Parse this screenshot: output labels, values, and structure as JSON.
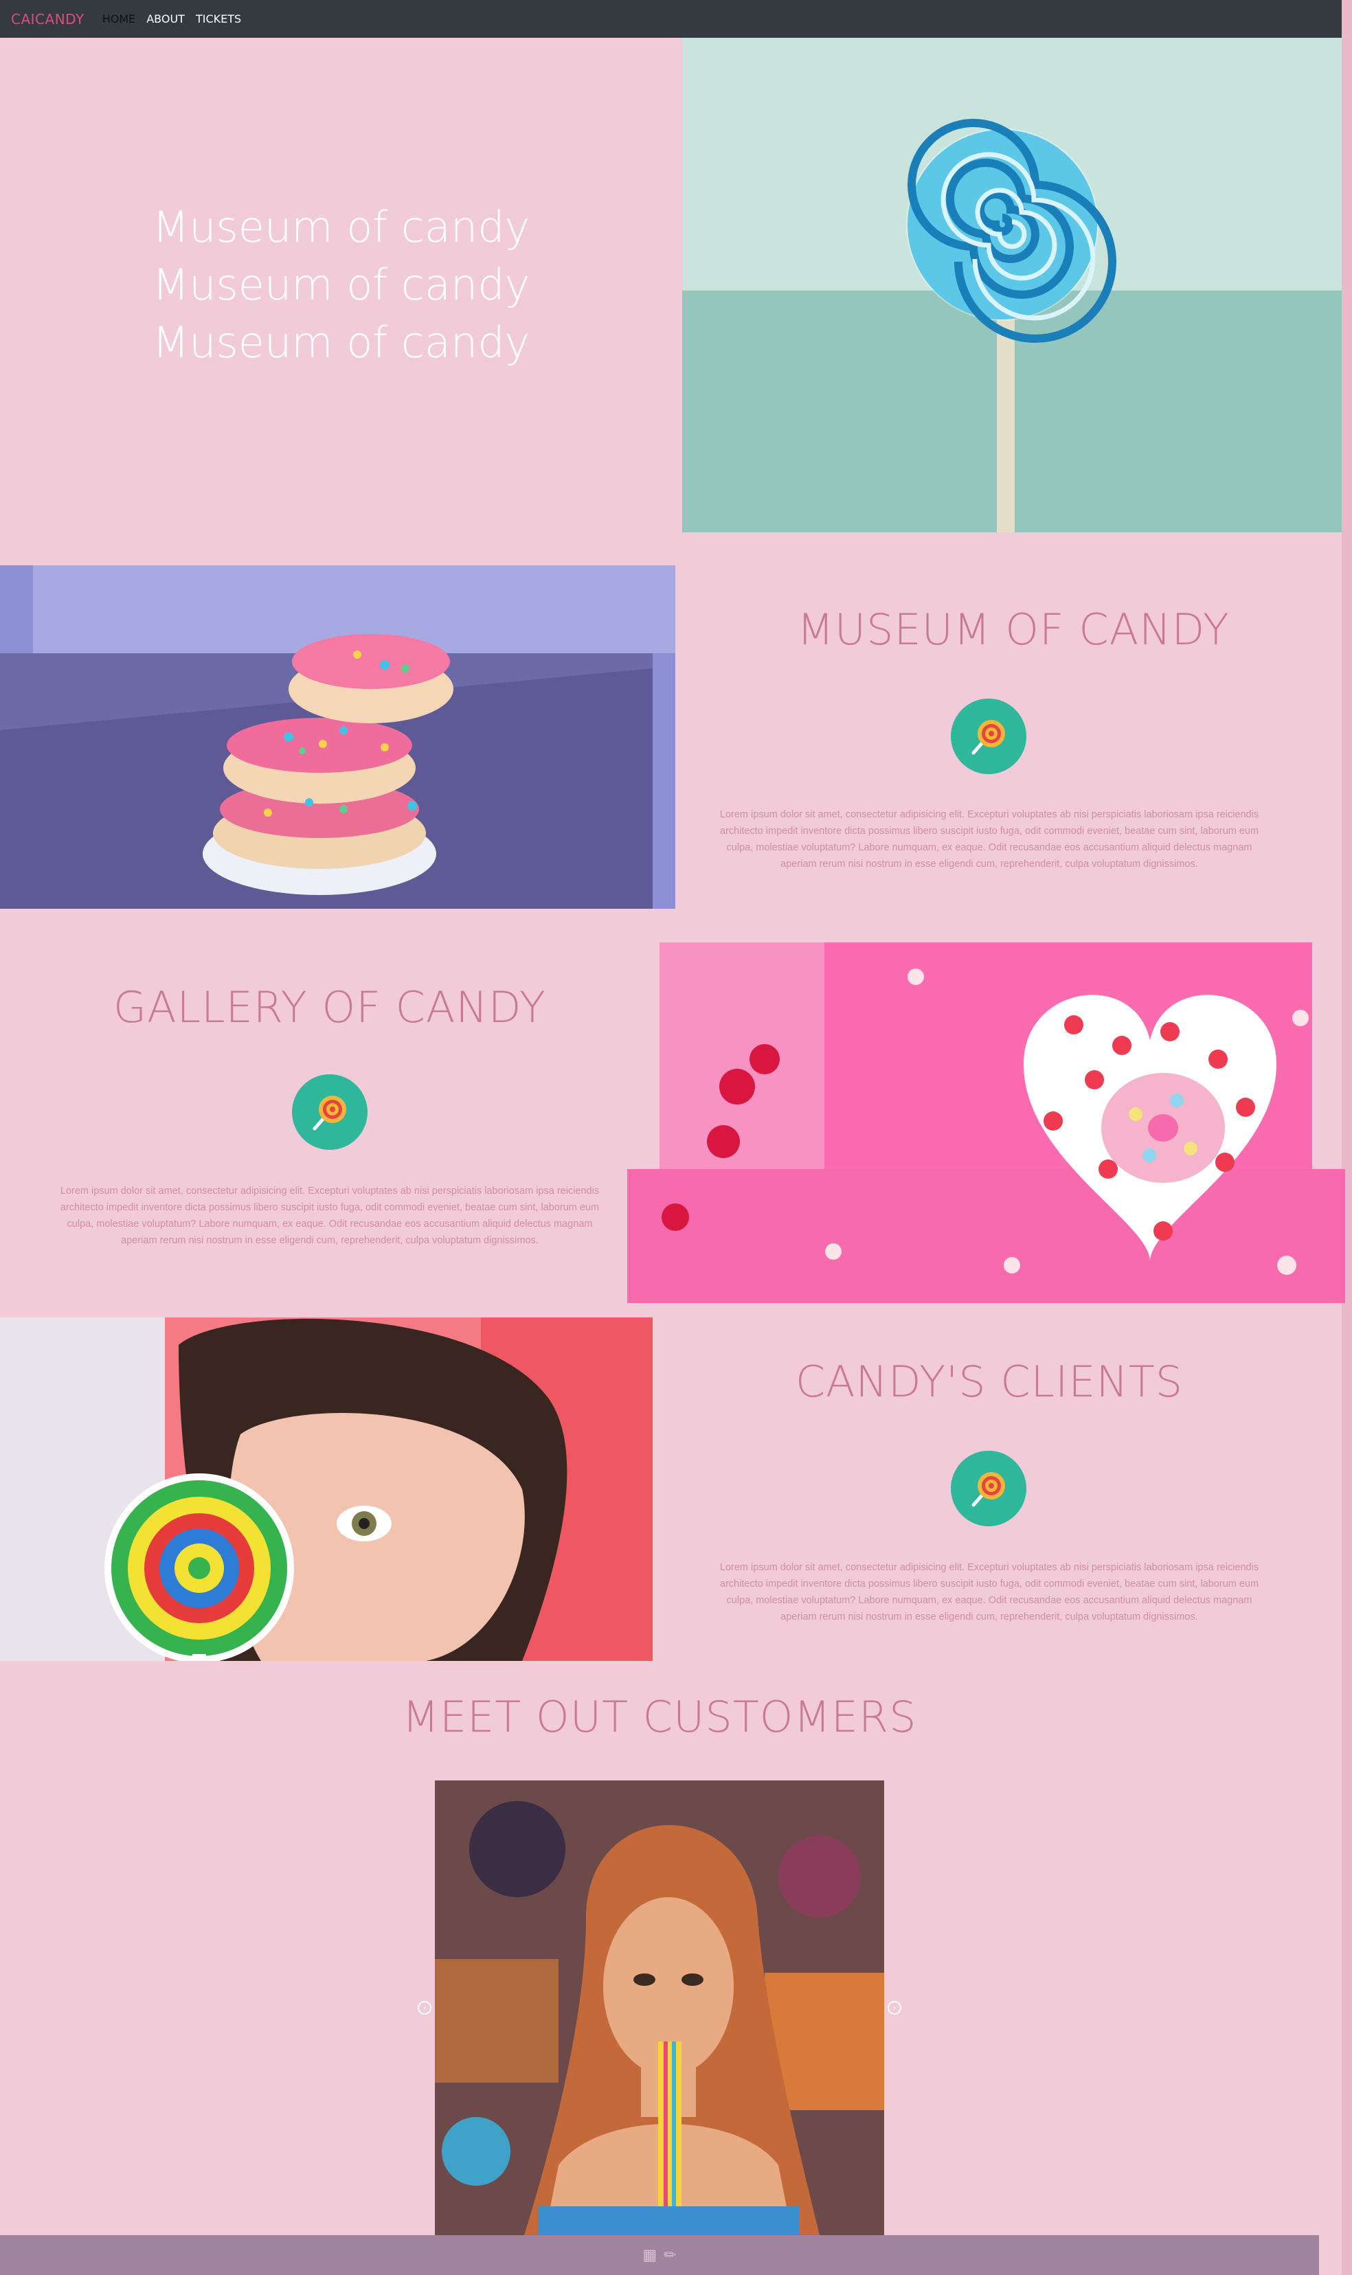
{
  "navbar": {
    "brand": "CAICANDY",
    "links": [
      "HOME",
      "ABOUT",
      "TICKETS"
    ]
  },
  "hero": {
    "lines": [
      "Museum of candy",
      "Museum of candy",
      "Museum of candy"
    ]
  },
  "sections": [
    {
      "title": "MUSEUM OF CANDY",
      "text": "Lorem ipsum dolor sit amet, consectetur adipisicing elit. Excepturi voluptates ab nisi perspiciatis laboriosam ipsa reiciendis architecto impedit inventore dicta possimus libero suscipit iusto fuga, odit commodi eveniet, beatae cum sint, laborum eum culpa, molestiae voluptatum? Labore numquam, ex eaque. Odit recusandae eos accusantium aliquid delectus magnam aperiam rerum nisi nostrum in esse eligendi cum, reprehenderit, culpa voluptatum dignissimos."
    },
    {
      "title": "GALLERY OF CANDY",
      "text": "Lorem ipsum dolor sit amet, consectetur adipisicing elit. Excepturi voluptates ab nisi perspiciatis laboriosam ipsa reiciendis architecto impedit inventore dicta possimus libero suscipit iusto fuga, odit commodi eveniet, beatae cum sint, laborum eum culpa, molestiae voluptatum? Labore numquam, ex eaque. Odit recusandae eos accusantium aliquid delectus magnam aperiam rerum nisi nostrum in esse eligendi cum, reprehenderit, culpa voluptatum dignissimos."
    },
    {
      "title": "CANDY'S CLIENTS",
      "text": "Lorem ipsum dolor sit amet, consectetur adipisicing elit. Excepturi voluptates ab nisi perspiciatis laboriosam ipsa reiciendis architecto impedit inventore dicta possimus libero suscipit iusto fuga, odit commodi eveniet, beatae cum sint, laborum eum culpa, molestiae voluptatum? Labore numquam, ex eaque. Odit recusandae eos accusantium aliquid delectus magnam aperiam rerum nisi nostrum in esse eligendi cum, reprehenderit, culpa voluptatum dignissimos."
    }
  ],
  "customers": {
    "title": "MEET OUT CUSTOMERS"
  },
  "icons": {
    "section_badge": "lollipop-icon",
    "carousel_prev": "chevron-left-icon",
    "carousel_next": "chevron-right-icon",
    "footer": [
      "cake-icon",
      "candy-icon"
    ]
  },
  "colors": {
    "page_bg": "#f2cbd8",
    "navbar_bg": "#343a40",
    "brand": "#d94f7c",
    "title": "#c97896",
    "badge": "#2eb79b",
    "footer_bg": "#a0849e"
  }
}
